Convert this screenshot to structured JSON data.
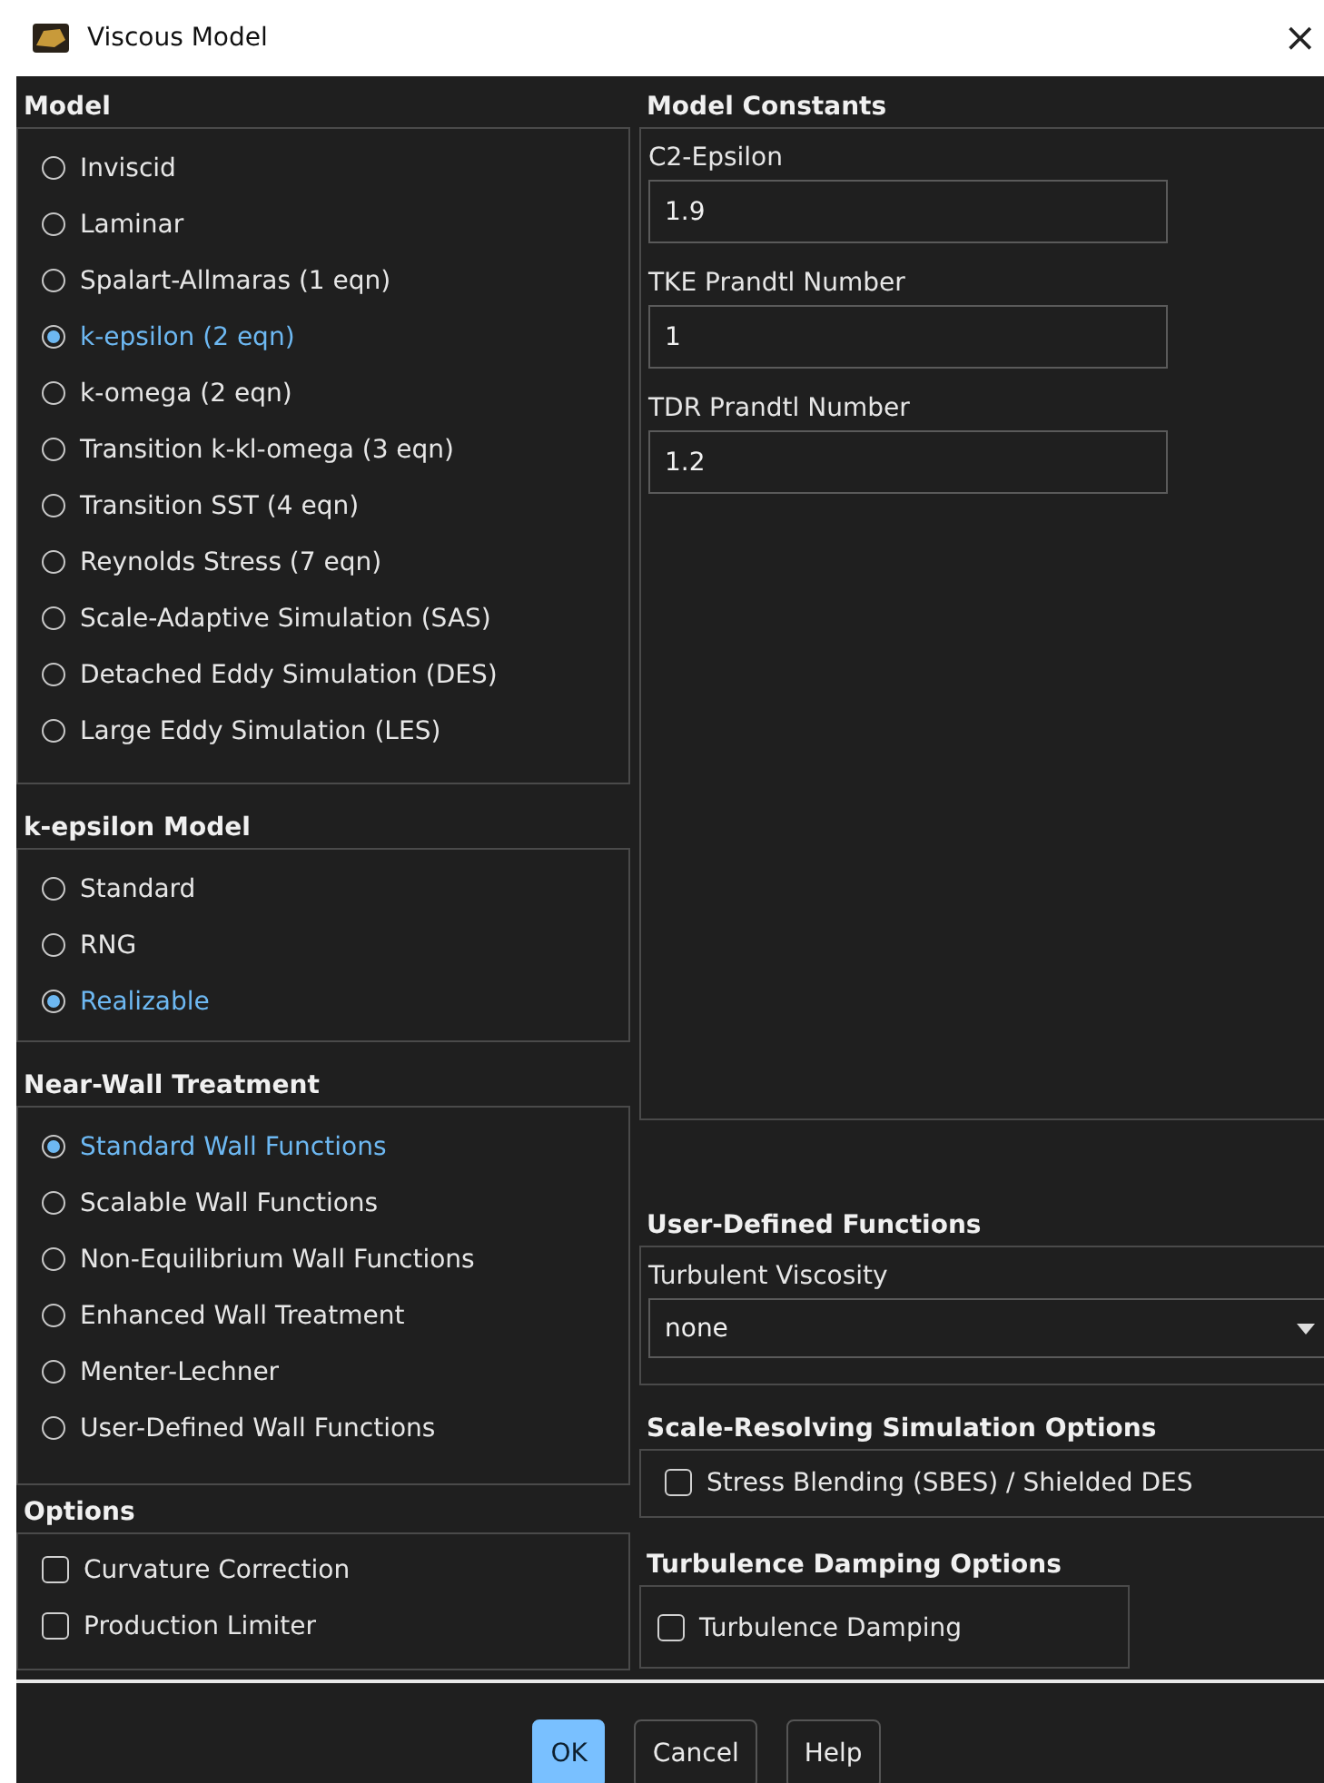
{
  "window": {
    "title": "Viscous Model",
    "close": "×"
  },
  "model": {
    "title": "Model",
    "options": [
      {
        "label": "Inviscid",
        "selected": false
      },
      {
        "label": "Laminar",
        "selected": false
      },
      {
        "label": "Spalart-Allmaras (1 eqn)",
        "selected": false
      },
      {
        "label": "k-epsilon (2 eqn)",
        "selected": true
      },
      {
        "label": "k-omega (2 eqn)",
        "selected": false
      },
      {
        "label": "Transition k-kl-omega (3 eqn)",
        "selected": false
      },
      {
        "label": "Transition SST (4 eqn)",
        "selected": false
      },
      {
        "label": "Reynolds Stress (7 eqn)",
        "selected": false
      },
      {
        "label": "Scale-Adaptive Simulation (SAS)",
        "selected": false
      },
      {
        "label": "Detached Eddy Simulation (DES)",
        "selected": false
      },
      {
        "label": "Large Eddy Simulation (LES)",
        "selected": false
      }
    ]
  },
  "k_epsilon_model": {
    "title": "k-epsilon Model",
    "options": [
      {
        "label": "Standard",
        "selected": false
      },
      {
        "label": "RNG",
        "selected": false
      },
      {
        "label": "Realizable",
        "selected": true
      }
    ]
  },
  "near_wall_treatment": {
    "title": "Near-Wall Treatment",
    "options": [
      {
        "label": "Standard Wall Functions",
        "selected": true
      },
      {
        "label": "Scalable Wall Functions",
        "selected": false
      },
      {
        "label": "Non-Equilibrium Wall Functions",
        "selected": false
      },
      {
        "label": "Enhanced Wall Treatment",
        "selected": false
      },
      {
        "label": "Menter-Lechner",
        "selected": false
      },
      {
        "label": "User-Defined Wall Functions",
        "selected": false
      }
    ]
  },
  "options": {
    "title": "Options",
    "items": [
      {
        "label": "Curvature Correction",
        "checked": false
      },
      {
        "label": "Production Limiter",
        "checked": false
      }
    ]
  },
  "model_constants": {
    "title": "Model Constants",
    "fields": [
      {
        "label": "C2-Epsilon",
        "value": "1.9"
      },
      {
        "label": "TKE Prandtl Number",
        "value": "1"
      },
      {
        "label": "TDR Prandtl Number",
        "value": "1.2"
      }
    ]
  },
  "user_defined_functions": {
    "title": "User-Defined Functions",
    "label": "Turbulent Viscosity",
    "value": "none"
  },
  "scale_resolving": {
    "title": "Scale-Resolving Simulation Options",
    "items": [
      {
        "label": "Stress Blending (SBES) / Shielded DES",
        "checked": false
      }
    ]
  },
  "turbulence_damping": {
    "title": "Turbulence Damping Options",
    "items": [
      {
        "label": "Turbulence Damping",
        "checked": false
      }
    ]
  },
  "buttons": [
    {
      "label": "OK",
      "default": true
    },
    {
      "label": "Cancel",
      "default": false
    },
    {
      "label": "Help",
      "default": false
    }
  ]
}
